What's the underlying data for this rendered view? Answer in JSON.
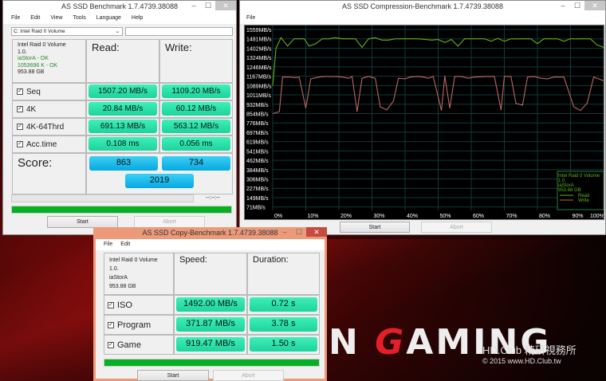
{
  "background": {
    "logo_prefix": "N ",
    "logo_g": "G",
    "logo_rest": "AMING",
    "watermark_line1": "HD.Club 精研視務所",
    "watermark_line2": "© 2015  www.HD.Club.tw"
  },
  "main": {
    "title": "AS SSD Benchmark 1.7.4739.38088",
    "menu": [
      "File",
      "Edit",
      "View",
      "Tools",
      "Language",
      "Help"
    ],
    "drive_select": "C: Intel Raid 0 Volume",
    "info": {
      "name": "Intel Raid 0 Volume",
      "version": "1.0.",
      "driver": "iaStorA - OK",
      "align": "1053696 K - OK",
      "size": "953.88 GB"
    },
    "read_header": "Read:",
    "write_header": "Write:",
    "rows": [
      {
        "label": "Seq",
        "read": "1507.20 MB/s",
        "write": "1109.20 MB/s",
        "checked": true
      },
      {
        "label": "4K",
        "read": "20.84 MB/s",
        "write": "60.12 MB/s",
        "checked": true
      },
      {
        "label": "4K-64Thrd",
        "read": "691.13 MB/s",
        "write": "563.12 MB/s",
        "checked": true
      },
      {
        "label": "Acc.time",
        "read": "0.108 ms",
        "write": "0.056 ms",
        "checked": true
      }
    ],
    "score_label": "Score:",
    "score_read": "863",
    "score_write": "734",
    "score_total": "2019",
    "time": "--:--:--",
    "progress": 100,
    "start": "Start",
    "abort": "Abort"
  },
  "compression": {
    "title": "AS SSD Compression-Benchmark 1.7.4739.38088",
    "menu": [
      "File"
    ],
    "start": "Start",
    "abort": "Abort",
    "legend": {
      "name": "Intel Raid 0 Volume",
      "version": "1.0.",
      "driver": "iaStorA",
      "size": "953.88 GB",
      "read": "Read",
      "write": "Write"
    }
  },
  "chart_data": {
    "type": "line",
    "y_tick_labels": [
      "1559MB/s",
      "1481MB/s",
      "1402MB/s",
      "1324MB/s",
      "1246MB/s",
      "1167MB/s",
      "1089MB/s",
      "1011MB/s",
      "932MB/s",
      "854MB/s",
      "776MB/s",
      "697MB/s",
      "619MB/s",
      "541MB/s",
      "462MB/s",
      "384MB/s",
      "306MB/s",
      "227MB/s",
      "149MB/s",
      "71MB/s"
    ],
    "x_tick_labels": [
      "0%",
      "10%",
      "20%",
      "30%",
      "40%",
      "50%",
      "60%",
      "70%",
      "80%",
      "90%",
      "100%"
    ],
    "xlim": [
      0,
      100
    ],
    "ylim": [
      0,
      1600
    ],
    "grid": true,
    "legend": "bottom-right",
    "series": [
      {
        "name": "Read",
        "color": "#5fb31a",
        "x": [
          0,
          1,
          2.5,
          4.5,
          6.5,
          9.5,
          11,
          13,
          15,
          17,
          19,
          21,
          23,
          25,
          27,
          29,
          31,
          33,
          35,
          37,
          40,
          44,
          48,
          50,
          52,
          54,
          56,
          58,
          60,
          62,
          64,
          66,
          68,
          70,
          72,
          74,
          76,
          78,
          80,
          82,
          84,
          86,
          88,
          90,
          92,
          94,
          96,
          98,
          100
        ],
        "y": [
          1089,
          1402,
          1490,
          1420,
          1481,
          1481,
          1420,
          1440,
          1481,
          1481,
          1490,
          1481,
          1481,
          1481,
          1410,
          1481,
          1490,
          1470,
          1470,
          1481,
          1481,
          1481,
          1470,
          1475,
          1450,
          1475,
          1420,
          1481,
          1481,
          1481,
          1481,
          1460,
          1485,
          1460,
          1481,
          1480,
          1481,
          1481,
          1440,
          1481,
          1481,
          1481,
          1460,
          1481,
          1480,
          1481,
          1481,
          1430,
          1410
        ]
      },
      {
        "name": "Write",
        "color": "#c06464",
        "x": [
          0,
          2,
          3,
          5,
          7,
          8,
          10,
          11.5,
          14,
          16,
          19,
          21,
          23,
          24,
          25.5,
          27,
          29,
          31,
          32.5,
          34.5,
          36.5,
          38,
          40,
          41.5,
          44,
          45.5,
          47,
          48.5,
          51,
          52,
          53.5,
          55,
          57,
          59,
          61,
          65,
          67,
          69,
          70,
          72,
          73.5,
          75.5,
          77,
          79,
          81,
          83,
          85,
          86.5,
          88,
          91,
          93,
          95,
          97,
          100
        ],
        "y": [
          854,
          870,
          1160,
          1160,
          1155,
          1160,
          900,
          1145,
          1160,
          1165,
          1165,
          1160,
          1150,
          1165,
          870,
          1150,
          1165,
          1150,
          910,
          885,
          960,
          1150,
          1145,
          1160,
          1165,
          1160,
          1150,
          1165,
          880,
          1170,
          900,
          1165,
          1165,
          1150,
          1160,
          1165,
          1165,
          885,
          1165,
          1165,
          940,
          925,
          1160,
          1165,
          1150,
          1145,
          1160,
          1160,
          1160,
          910,
          880,
          940,
          1160,
          1130
        ]
      }
    ]
  },
  "copy": {
    "title": "AS SSD Copy-Benchmark 1.7.4739.38088",
    "menu": [
      "File",
      "Edit"
    ],
    "info": {
      "name": "Intel Raid 0 Volume",
      "version": "1.0.",
      "driver": "iaStorA",
      "size": "953.88 GB"
    },
    "speed_header": "Speed:",
    "duration_header": "Duration:",
    "rows": [
      {
        "label": "ISO",
        "speed": "1492.00 MB/s",
        "duration": "0.72 s",
        "checked": true
      },
      {
        "label": "Program",
        "speed": "371.87 MB/s",
        "duration": "3.78 s",
        "checked": true
      },
      {
        "label": "Game",
        "speed": "919.47 MB/s",
        "duration": "1.50 s",
        "checked": true
      }
    ],
    "progress": 100,
    "start": "Start",
    "abort": "Abort"
  }
}
